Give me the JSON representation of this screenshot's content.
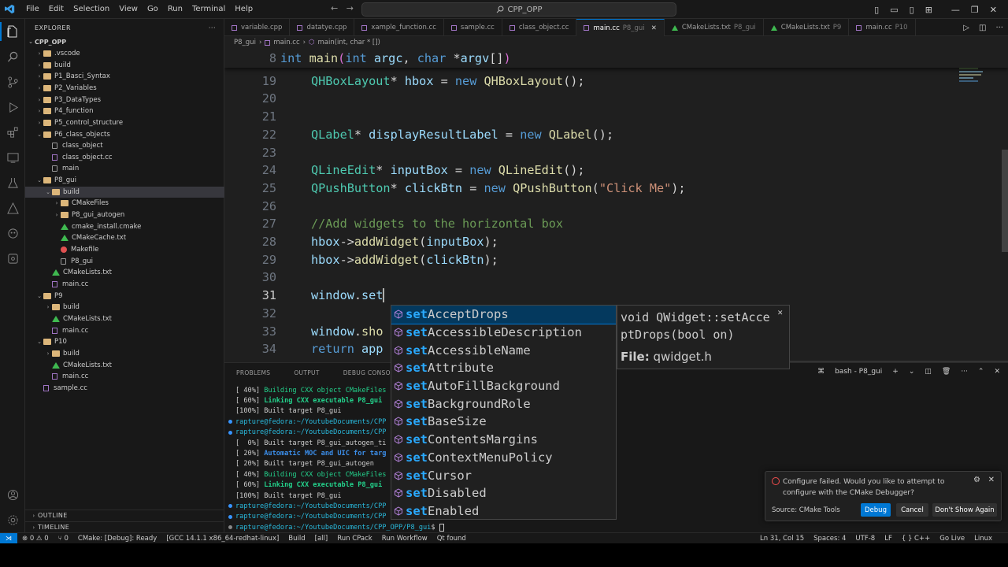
{
  "titlebar": {
    "menu": [
      "File",
      "Edit",
      "Selection",
      "View",
      "Go",
      "Run",
      "Terminal",
      "Help"
    ],
    "search": "CPP_OPP"
  },
  "sidebar": {
    "header": "EXPLORER",
    "root": "CPP_OPP",
    "items": [
      {
        "label": ".vscode",
        "depth": 1,
        "kind": "folder",
        "open": false
      },
      {
        "label": "build",
        "depth": 1,
        "kind": "folder",
        "open": false
      },
      {
        "label": "P1_Basci_Syntax",
        "depth": 1,
        "kind": "folder",
        "open": false
      },
      {
        "label": "P2_Variables",
        "depth": 1,
        "kind": "folder",
        "open": false
      },
      {
        "label": "P3_DataTypes",
        "depth": 1,
        "kind": "folder",
        "open": false
      },
      {
        "label": "P4_function",
        "depth": 1,
        "kind": "folder",
        "open": false
      },
      {
        "label": "P5_control_structure",
        "depth": 1,
        "kind": "folder",
        "open": false
      },
      {
        "label": "P6_class_objects",
        "depth": 1,
        "kind": "folder",
        "open": true
      },
      {
        "label": "class_object",
        "depth": 2,
        "kind": "file"
      },
      {
        "label": "class_object.cc",
        "depth": 2,
        "kind": "cc"
      },
      {
        "label": "main",
        "depth": 2,
        "kind": "file"
      },
      {
        "label": "P8_gui",
        "depth": 1,
        "kind": "folder",
        "open": true
      },
      {
        "label": "build",
        "depth": 2,
        "kind": "folder",
        "open": true,
        "selected": true
      },
      {
        "label": "CMakeFiles",
        "depth": 3,
        "kind": "folder",
        "open": false
      },
      {
        "label": "P8_gui_autogen",
        "depth": 3,
        "kind": "folder",
        "open": false
      },
      {
        "label": "cmake_install.cmake",
        "depth": 3,
        "kind": "cmake"
      },
      {
        "label": "CMakeCache.txt",
        "depth": 3,
        "kind": "cmake"
      },
      {
        "label": "Makefile",
        "depth": 3,
        "kind": "make"
      },
      {
        "label": "P8_gui",
        "depth": 3,
        "kind": "file"
      },
      {
        "label": "CMakeLists.txt",
        "depth": 2,
        "kind": "cmake"
      },
      {
        "label": "main.cc",
        "depth": 2,
        "kind": "cc"
      },
      {
        "label": "P9",
        "depth": 1,
        "kind": "folder",
        "open": true
      },
      {
        "label": "build",
        "depth": 2,
        "kind": "folder",
        "open": false
      },
      {
        "label": "CMakeLists.txt",
        "depth": 2,
        "kind": "cmake"
      },
      {
        "label": "main.cc",
        "depth": 2,
        "kind": "cc"
      },
      {
        "label": "P10",
        "depth": 1,
        "kind": "folder",
        "open": true
      },
      {
        "label": "build",
        "depth": 2,
        "kind": "folder",
        "open": false
      },
      {
        "label": "CMakeLists.txt",
        "depth": 2,
        "kind": "cmake"
      },
      {
        "label": "main.cc",
        "depth": 2,
        "kind": "cc"
      },
      {
        "label": "sample.cc",
        "depth": 1,
        "kind": "cc"
      }
    ],
    "outline": "OUTLINE",
    "timeline": "TIMELINE"
  },
  "tabs": [
    {
      "label": "variable.cpp",
      "sub": "",
      "kind": "cc"
    },
    {
      "label": "datatye.cpp",
      "sub": "",
      "kind": "cc"
    },
    {
      "label": "xample_function.cc",
      "sub": "",
      "kind": "cc"
    },
    {
      "label": "sample.cc",
      "sub": "",
      "kind": "cc"
    },
    {
      "label": "class_object.cc",
      "sub": "",
      "kind": "cc"
    },
    {
      "label": "main.cc",
      "sub": "P8_gui",
      "kind": "cc",
      "active": true
    },
    {
      "label": "CMakeLists.txt",
      "sub": "P8_gui",
      "kind": "cmake"
    },
    {
      "label": "CMakeLists.txt",
      "sub": "P9",
      "kind": "cmake"
    },
    {
      "label": "main.cc",
      "sub": "P10",
      "kind": "cc"
    }
  ],
  "breadcrumb": [
    "P8_gui",
    "main.cc",
    "main(int, char * [])"
  ],
  "editor": {
    "sticky": {
      "num": "8",
      "code": [
        [
          "kw",
          "int "
        ],
        [
          "fn",
          "main"
        ],
        [
          "pu",
          "("
        ],
        [
          "kw",
          "int "
        ],
        [
          "va",
          "argc"
        ],
        [
          "pl",
          ", "
        ],
        [
          "kw",
          "char "
        ],
        [
          "pl",
          "*"
        ],
        [
          "va",
          "argv"
        ],
        [
          "pl",
          "[]"
        ],
        [
          "pu",
          ")"
        ]
      ]
    },
    "lines": [
      {
        "num": "19",
        "code": [
          [
            "ty",
            "QHBoxLayout"
          ],
          [
            "pl",
            "* "
          ],
          [
            "va",
            "hbox"
          ],
          [
            "pl",
            " = "
          ],
          [
            "kw",
            "new "
          ],
          [
            "fn",
            "QHBoxLayout"
          ],
          [
            "pl",
            "();"
          ]
        ]
      },
      {
        "num": "20",
        "code": []
      },
      {
        "num": "21",
        "code": []
      },
      {
        "num": "22",
        "code": [
          [
            "ty",
            "QLabel"
          ],
          [
            "pl",
            "* "
          ],
          [
            "va",
            "displayResultLabel"
          ],
          [
            "pl",
            " = "
          ],
          [
            "kw",
            "new "
          ],
          [
            "fn",
            "QLabel"
          ],
          [
            "pl",
            "();"
          ]
        ]
      },
      {
        "num": "23",
        "code": []
      },
      {
        "num": "24",
        "code": [
          [
            "ty",
            "QLineEdit"
          ],
          [
            "pl",
            "* "
          ],
          [
            "va",
            "inputBox"
          ],
          [
            "pl",
            " = "
          ],
          [
            "kw",
            "new "
          ],
          [
            "fn",
            "QLineEdit"
          ],
          [
            "pl",
            "();"
          ]
        ]
      },
      {
        "num": "25",
        "code": [
          [
            "ty",
            "QPushButton"
          ],
          [
            "pl",
            "* "
          ],
          [
            "va",
            "clickBtn"
          ],
          [
            "pl",
            " = "
          ],
          [
            "kw",
            "new "
          ],
          [
            "fn",
            "QPushButton"
          ],
          [
            "pl",
            "("
          ],
          [
            "st",
            "\"Click Me\""
          ],
          [
            "pl",
            ");"
          ]
        ]
      },
      {
        "num": "26",
        "code": []
      },
      {
        "num": "27",
        "code": [
          [
            "cm",
            "//Add widgets to the horizontal box"
          ]
        ]
      },
      {
        "num": "28",
        "code": [
          [
            "va",
            "hbox"
          ],
          [
            "pl",
            "->"
          ],
          [
            "fn",
            "addWidget"
          ],
          [
            "pl",
            "("
          ],
          [
            "va",
            "inputBox"
          ],
          [
            "pl",
            ");"
          ]
        ]
      },
      {
        "num": "29",
        "code": [
          [
            "va",
            "hbox"
          ],
          [
            "pl",
            "->"
          ],
          [
            "fn",
            "addWidget"
          ],
          [
            "pl",
            "("
          ],
          [
            "va",
            "clickBtn"
          ],
          [
            "pl",
            ");"
          ]
        ]
      },
      {
        "num": "30",
        "code": []
      },
      {
        "num": "31",
        "code": [
          [
            "va",
            "window"
          ],
          [
            "pl",
            "."
          ],
          [
            "va",
            "set"
          ]
        ],
        "current": true
      },
      {
        "num": "32",
        "code": []
      },
      {
        "num": "33",
        "code": [
          [
            "va",
            "window"
          ],
          [
            "pl",
            "."
          ],
          [
            "fn",
            "sho"
          ]
        ]
      },
      {
        "num": "34",
        "code": [
          [
            "kw",
            "return "
          ],
          [
            "va",
            "app"
          ]
        ]
      }
    ]
  },
  "suggest": {
    "match": "set",
    "items": [
      "AcceptDrops",
      "AccessibleDescription",
      "AccessibleName",
      "Attribute",
      "AutoFillBackground",
      "BackgroundRole",
      "BaseSize",
      "ContentsMargins",
      "ContextMenuPolicy",
      "Cursor",
      "Disabled",
      "Enabled"
    ],
    "detail_signature": "void QWidget::setAcceptDrops(bool on)",
    "detail_file_label": "File:",
    "detail_file": "qwidget.h"
  },
  "panel": {
    "tabs": [
      "PROBLEMS",
      "OUTPUT",
      "DEBUG CONSOLE",
      "TERMI"
    ],
    "terminal_name": "bash - P8_gui",
    "lines": [
      {
        "dot": "",
        "segs": [
          [
            "",
            "[ 40%] "
          ],
          [
            "g",
            "Building CXX object CMakeFiles"
          ]
        ]
      },
      {
        "dot": "",
        "segs": [
          [
            "",
            "[ 60%] "
          ],
          [
            "gb",
            "Linking CXX executable P8_gui"
          ]
        ]
      },
      {
        "dot": "",
        "segs": [
          [
            "",
            "[100%] Built target P8_gui"
          ]
        ]
      },
      {
        "dot": "b",
        "segs": [
          [
            "c",
            "rapture@fedora:~/YoutubeDocuments/CPP"
          ]
        ]
      },
      {
        "dot": "b",
        "segs": [
          [
            "c",
            "rapture@fedora:~/YoutubeDocuments/CPP"
          ]
        ]
      },
      {
        "dot": "",
        "segs": [
          [
            "",
            "[  0%] Built target P8_gui_autogen_ti"
          ]
        ]
      },
      {
        "dot": "",
        "segs": [
          [
            "",
            "[ 20%] "
          ],
          [
            "cb",
            "Automatic MOC and UIC for targ"
          ]
        ]
      },
      {
        "dot": "",
        "segs": [
          [
            "",
            "[ 20%] Built target P8_gui_autogen"
          ]
        ]
      },
      {
        "dot": "",
        "segs": [
          [
            "",
            "[ 40%] "
          ],
          [
            "g",
            "Building CXX object CMakeFiles"
          ]
        ]
      },
      {
        "dot": "",
        "segs": [
          [
            "",
            "[ 60%] "
          ],
          [
            "gb",
            "Linking CXX executable P8_gui"
          ]
        ]
      },
      {
        "dot": "",
        "segs": [
          [
            "",
            "[100%] Built target P8_gui"
          ]
        ]
      },
      {
        "dot": "b",
        "segs": [
          [
            "c",
            "rapture@fedora:~/YoutubeDocuments/CPP"
          ]
        ]
      },
      {
        "dot": "b",
        "segs": [
          [
            "c",
            "rapture@fedora:~/YoutubeDocuments/CPP"
          ]
        ]
      },
      {
        "dot": "g",
        "segs": [
          [
            "c",
            "rapture@fedora:~/YoutubeDocuments/CPP_OPP/P8_gui"
          ],
          [
            "",
            "$ "
          ]
        ]
      }
    ]
  },
  "notification": {
    "message": "Configure failed. Would you like to attempt to configure with the CMake Debugger?",
    "source": "Source: CMake Tools",
    "buttons": [
      "Debug",
      "Cancel",
      "Don't Show Again"
    ]
  },
  "statusbar": {
    "left": [
      "⊗ 0 ⚠ 0",
      "⑂ 0",
      "CMake: [Debug]: Ready",
      "[GCC 14.1.1 x86_64-redhat-linux]",
      "Build",
      "[all]",
      "Run CPack",
      "Run Workflow",
      "Qt found"
    ],
    "right": [
      "Ln 31, Col 15",
      "Spaces: 4",
      "UTF-8",
      "LF",
      "{ } C++",
      "Go Live",
      "Linux"
    ]
  },
  "colors": {
    "accent": "#0078d4",
    "match": "#2aaaff",
    "keyword": "#569cd6",
    "type": "#4ec9b0",
    "function": "#dcdcaa",
    "variable": "#9cdcfe",
    "string": "#ce9178",
    "comment": "#6a9955"
  }
}
